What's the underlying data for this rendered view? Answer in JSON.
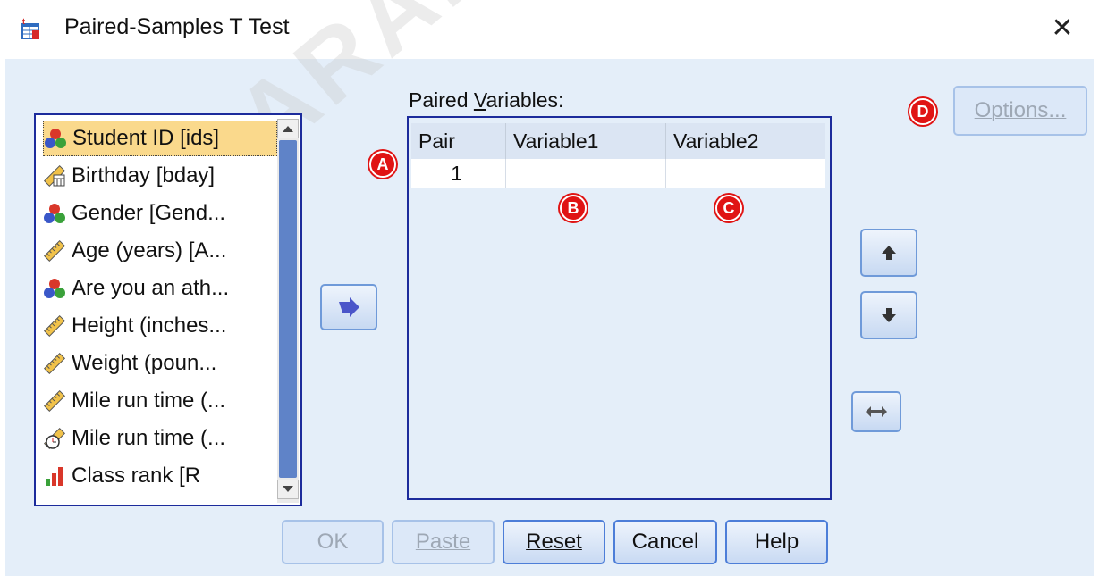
{
  "window": {
    "title": "Paired-Samples T Test",
    "close": "✕"
  },
  "variables": [
    {
      "label": "Student ID [ids]",
      "icon": "nominal-icon",
      "selected": true
    },
    {
      "label": "Birthday [bday]",
      "icon": "date-scale-icon"
    },
    {
      "label": "Gender [Gend...",
      "icon": "nominal-icon"
    },
    {
      "label": "Age (years) [A...",
      "icon": "scale-ruler-icon"
    },
    {
      "label": "Are you an ath...",
      "icon": "nominal-icon"
    },
    {
      "label": "Height (inches...",
      "icon": "scale-ruler-icon"
    },
    {
      "label": "Weight (poun...",
      "icon": "scale-ruler-icon"
    },
    {
      "label": "Mile run time (...",
      "icon": "scale-ruler-icon"
    },
    {
      "label": "Mile run time (...",
      "icon": "time-scale-icon"
    },
    {
      "label": "Class rank [R",
      "icon": "ordinal-icon"
    }
  ],
  "paired": {
    "label": "Paired Variables:",
    "label_underline_char": "V",
    "headers": [
      "Pair",
      "Variable1",
      "Variable2"
    ],
    "rows": [
      {
        "pair": "1",
        "var1": "",
        "var2": ""
      }
    ]
  },
  "annotations": {
    "a": "A",
    "b": "B",
    "c": "C",
    "d": "D"
  },
  "buttons": {
    "options": "Options...",
    "ok": "OK",
    "paste": "Paste",
    "reset": "Reset",
    "cancel": "Cancel",
    "help": "Help"
  },
  "watermark": "ARABPSYCH",
  "colors": {
    "accent": "#4d7ed8",
    "dialog_bg": "#e4eef9",
    "selected": "#fad98c",
    "annotation": "#e01414"
  }
}
